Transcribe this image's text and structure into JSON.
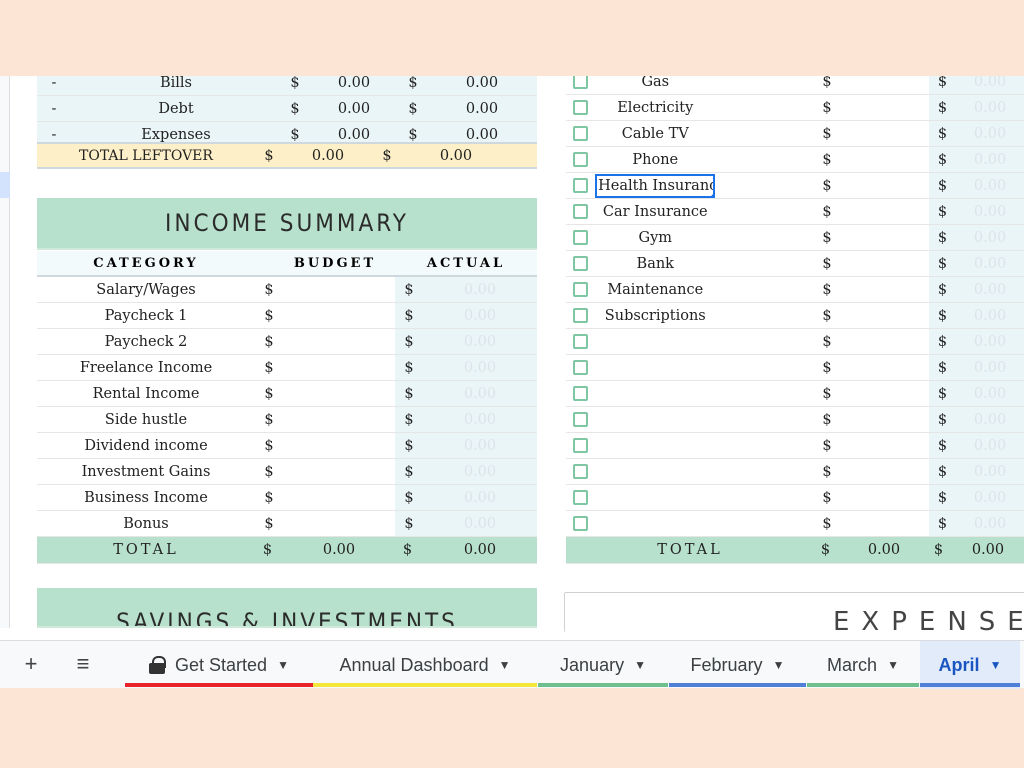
{
  "summary_rows": [
    {
      "dash": "-",
      "label": "Bills",
      "sym": "$",
      "budget": "0.00",
      "actual": "0.00"
    },
    {
      "dash": "-",
      "label": "Debt",
      "sym": "$",
      "budget": "0.00",
      "actual": "0.00"
    },
    {
      "dash": "-",
      "label": "Expenses",
      "sym": "$",
      "budget": "0.00",
      "actual": "0.00"
    }
  ],
  "total_leftover": {
    "label": "TOTAL LEFTOVER",
    "sym": "$",
    "budget": "0.00",
    "actual": "0.00"
  },
  "income": {
    "title": "INCOME SUMMARY",
    "headers": {
      "category": "CATEGORY",
      "budget": "BUDGET",
      "actual": "ACTUAL"
    },
    "rows": [
      {
        "label": "Salary/Wages",
        "sym": "$",
        "actual": "0.00"
      },
      {
        "label": "Paycheck 1",
        "sym": "$",
        "actual": "0.00"
      },
      {
        "label": "Paycheck 2",
        "sym": "$",
        "actual": "0.00"
      },
      {
        "label": "Freelance Income",
        "sym": "$",
        "actual": "0.00"
      },
      {
        "label": "Rental Income",
        "sym": "$",
        "actual": "0.00"
      },
      {
        "label": "Side hustle",
        "sym": "$",
        "actual": "0.00"
      },
      {
        "label": "Dividend income",
        "sym": "$",
        "actual": "0.00"
      },
      {
        "label": "Investment Gains",
        "sym": "$",
        "actual": "0.00"
      },
      {
        "label": "Business Income",
        "sym": "$",
        "actual": "0.00"
      },
      {
        "label": "Bonus",
        "sym": "$",
        "actual": "0.00"
      }
    ],
    "total": {
      "label": "TOTAL",
      "sym": "$",
      "budget": "0.00",
      "actual": "0.00"
    }
  },
  "savings": {
    "title": "SAVINGS & INVESTMENTS"
  },
  "bills": {
    "rows": [
      {
        "label": "Gas",
        "sym": "$",
        "actual": "0.00"
      },
      {
        "label": "Electricity",
        "sym": "$",
        "actual": "0.00"
      },
      {
        "label": "Cable TV",
        "sym": "$",
        "actual": "0.00"
      },
      {
        "label": "Phone",
        "sym": "$",
        "actual": "0.00"
      },
      {
        "label": "Health Insurance",
        "sym": "$",
        "actual": "0.00"
      },
      {
        "label": "Car Insurance",
        "sym": "$",
        "actual": "0.00"
      },
      {
        "label": "Gym",
        "sym": "$",
        "actual": "0.00"
      },
      {
        "label": "Bank",
        "sym": "$",
        "actual": "0.00"
      },
      {
        "label": "Maintenance",
        "sym": "$",
        "actual": "0.00"
      },
      {
        "label": "Subscriptions",
        "sym": "$",
        "actual": "0.00"
      },
      {
        "label": "",
        "sym": "$",
        "actual": "0.00"
      },
      {
        "label": "",
        "sym": "$",
        "actual": "0.00"
      },
      {
        "label": "",
        "sym": "$",
        "actual": "0.00"
      },
      {
        "label": "",
        "sym": "$",
        "actual": "0.00"
      },
      {
        "label": "",
        "sym": "$",
        "actual": "0.00"
      },
      {
        "label": "",
        "sym": "$",
        "actual": "0.00"
      },
      {
        "label": "",
        "sym": "$",
        "actual": "0.00"
      },
      {
        "label": "",
        "sym": "$",
        "actual": "0.00"
      }
    ],
    "total": {
      "label": "TOTAL",
      "sym": "$",
      "budget": "0.00",
      "actual": "0.00"
    }
  },
  "expenses_header": {
    "title": "EXPENSES"
  },
  "tabs": [
    {
      "label": "Get Started",
      "locked": true,
      "color": "#e8232a"
    },
    {
      "label": "Annual Dashboard",
      "color": "#f5e63a"
    },
    {
      "label": "January",
      "color": "#6fbf8e"
    },
    {
      "label": "February",
      "color": "#4f7fd6"
    },
    {
      "label": "March",
      "color": "#6fbf8e"
    },
    {
      "label": "April",
      "color": "#4f7fd6",
      "active": true
    }
  ],
  "toolbar": {
    "add_icon": "+",
    "menu_icon": "≡"
  },
  "colors": {
    "banner": "#b7e1cd",
    "leftover": "#fdefc7",
    "shade": "#eaf5f8",
    "selection": "#1a73e8"
  }
}
